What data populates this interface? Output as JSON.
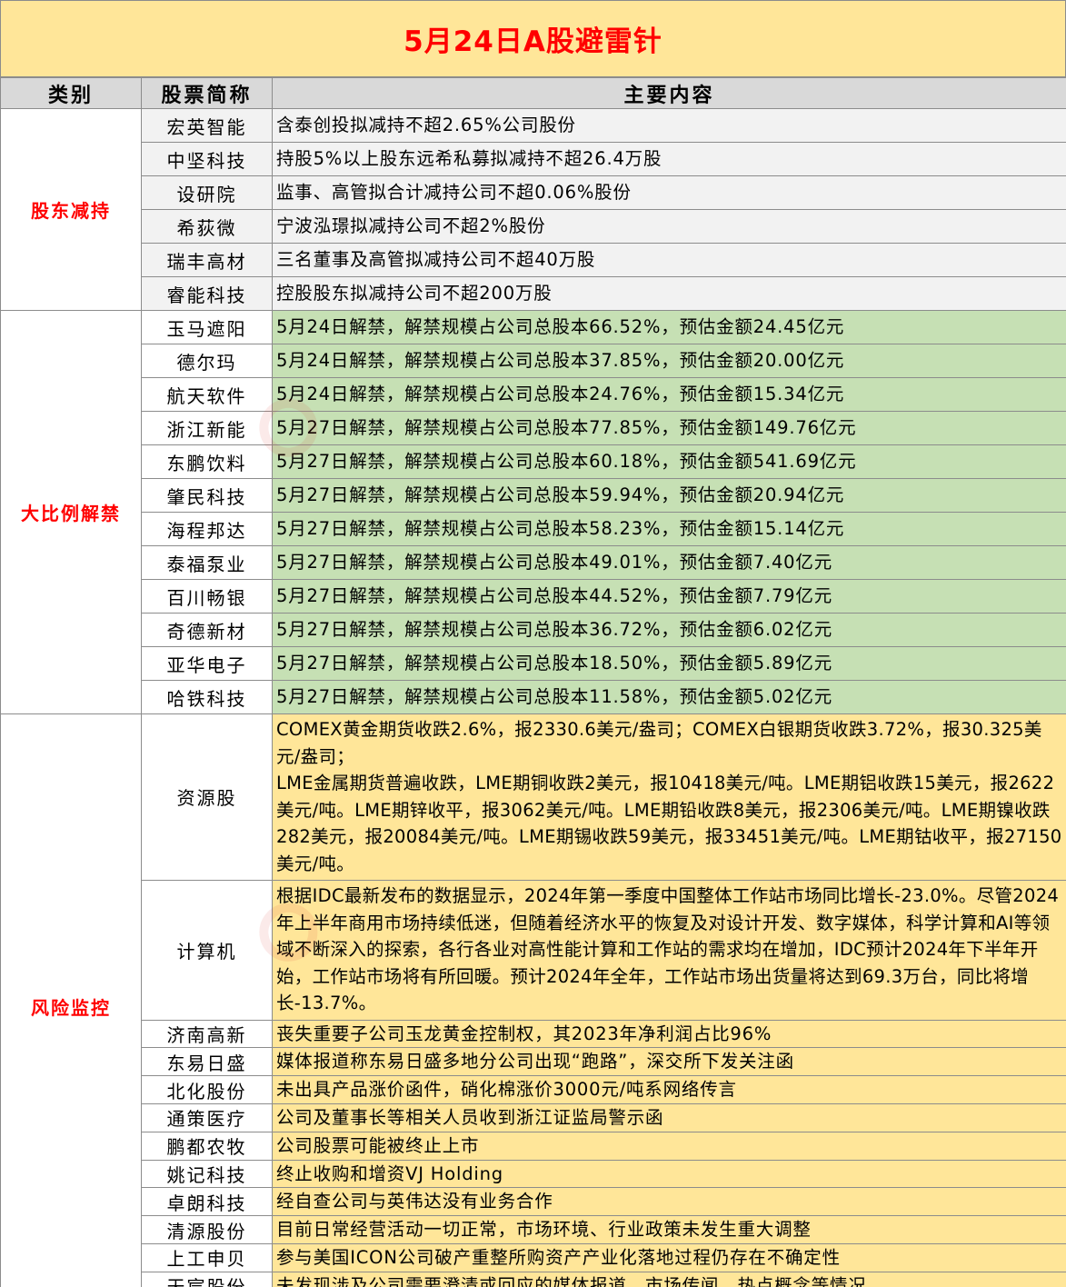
{
  "title": "5月24日A股避雷针",
  "headers": {
    "category": "类别",
    "stock": "股票简称",
    "content": "主要内容"
  },
  "sections": {
    "reduction": {
      "label": "股东减持",
      "rows": [
        {
          "name": "宏英智能",
          "content": "含泰创投拟减持不超2.65%公司股份"
        },
        {
          "name": "中坚科技",
          "content": "持股5%以上股东远希私募拟减持不超26.4万股"
        },
        {
          "name": "设研院",
          "content": "监事、高管拟合计减持公司不超0.06%股份"
        },
        {
          "name": "希荻微",
          "content": "宁波泓璟拟减持公司不超2%股份"
        },
        {
          "name": "瑞丰高材",
          "content": "三名董事及高管拟减持公司不超40万股"
        },
        {
          "name": "睿能科技",
          "content": "控股股东拟减持公司不超200万股"
        }
      ]
    },
    "unlock": {
      "label": "大比例解禁",
      "rows": [
        {
          "name": "玉马遮阳",
          "content": "5月24日解禁，解禁规模占公司总股本66.52%，预估金额24.45亿元"
        },
        {
          "name": "德尔玛",
          "content": "5月24日解禁，解禁规模占公司总股本37.85%，预估金额20.00亿元"
        },
        {
          "name": "航天软件",
          "content": "5月24日解禁，解禁规模占公司总股本24.76%，预估金额15.34亿元"
        },
        {
          "name": "浙江新能",
          "content": "5月27日解禁，解禁规模占公司总股本77.85%，预估金额149.76亿元"
        },
        {
          "name": "东鹏饮料",
          "content": "5月27日解禁，解禁规模占公司总股本60.18%，预估金额541.69亿元"
        },
        {
          "name": "肇民科技",
          "content": "5月27日解禁，解禁规模占公司总股本59.94%，预估金额20.94亿元"
        },
        {
          "name": "海程邦达",
          "content": "5月27日解禁，解禁规模占公司总股本58.23%，预估金额15.14亿元"
        },
        {
          "name": "泰福泵业",
          "content": "5月27日解禁，解禁规模占公司总股本49.01%，预估金额7.40亿元"
        },
        {
          "name": "百川畅银",
          "content": "5月27日解禁，解禁规模占公司总股本44.52%，预估金额7.79亿元"
        },
        {
          "name": "奇德新材",
          "content": "5月27日解禁，解禁规模占公司总股本36.72%，预估金额6.02亿元"
        },
        {
          "name": "亚华电子",
          "content": "5月27日解禁，解禁规模占公司总股本18.50%，预估金额5.89亿元"
        },
        {
          "name": "哈铁科技",
          "content": "5月27日解禁，解禁规模占公司总股本11.58%，预估金额5.02亿元"
        }
      ]
    },
    "risk": {
      "label": "风险监控",
      "rows": [
        {
          "name": "资源股",
          "content": "COMEX黄金期货收跌2.6%，报2330.6美元/盎司；COMEX白银期货收跌3.72%，报30.325美元/盎司；",
          "content2": "LME金属期货普遍收跌，LME期铜收跌2美元，报10418美元/吨。LME期铝收跌15美元，报2622美元/吨。LME期锌收平，报3062美元/吨。LME期铅收跌8美元，报2306美元/吨。LME期镍收跌282美元，报20084美元/吨。LME期锡收跌59美元，报33451美元/吨。LME期钴收平，报27150美元/吨。"
        },
        {
          "name": "计算机",
          "content": "根据IDC最新发布的数据显示，2024年第一季度中国整体工作站市场同比增长-23.0%。尽管2024年上半年商用市场持续低迷，但随着经济水平的恢复及对设计开发、数字媒体，科学计算和AI等领域不断深入的探索，各行各业对高性能计算和工作站的需求均在增加，IDC预计2024年下半年开始，工作站市场将有所回暖。预计2024年全年，工作站市场出货量将达到69.3万台，同比将增长-13.7%。"
        },
        {
          "name": "济南高新",
          "content": "丧失重要子公司玉龙黄金控制权，其2023年净利润占比96%"
        },
        {
          "name": "东易日盛",
          "content": "媒体报道称东易日盛多地分公司出现“跑路”，深交所下发关注函"
        },
        {
          "name": "北化股份",
          "content": "未出具产品涨价函件，硝化棉涨价3000元/吨系网络传言"
        },
        {
          "name": "通策医疗",
          "content": "公司及董事长等相关人员收到浙江证监局警示函"
        },
        {
          "name": "鹏都农牧",
          "content": "公司股票可能被终止上市"
        },
        {
          "name": "姚记科技",
          "content": "终止收购和增资VJ Holding"
        },
        {
          "name": "卓朗科技",
          "content": "经自查公司与英伟达没有业务合作"
        },
        {
          "name": "清源股份",
          "content": "目前日常经营活动一切正常，市场环境、行业政策未发生重大调整"
        },
        {
          "name": "上工申贝",
          "content": "参与美国ICON公司破产重整所购资产产业化落地过程仍存在不确定性"
        },
        {
          "name": "天宸股份",
          "content": "未发现涉及公司需要澄清或回应的媒体报道、市场传闻、热点概念等情况"
        }
      ]
    }
  },
  "colors": {
    "title_bg": "#ffe699",
    "title_text": "#ff0000",
    "header_bg": "#d9d9d9",
    "reduction_bg": "#f2f2f2",
    "unlock_bg": "#c6e0b4",
    "risk_bg": "#ffe699",
    "category_text": "#ff0000"
  }
}
